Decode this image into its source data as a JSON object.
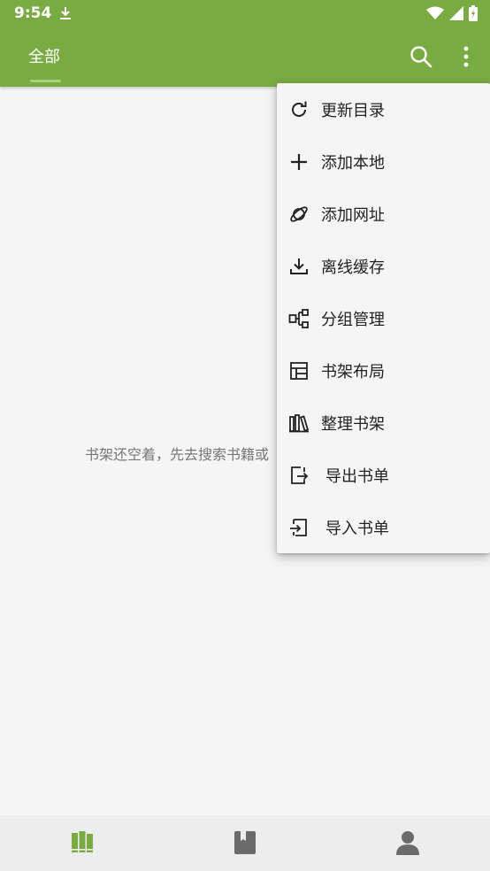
{
  "status": {
    "time": "9:54"
  },
  "appbar": {
    "tab_all": "全部",
    "search_icon": "search-icon",
    "more_icon": "more-vert-icon"
  },
  "empty_state": {
    "message": "书架还空着，先去搜索书籍或"
  },
  "menu": {
    "items": [
      {
        "label": "更新目录",
        "icon": "refresh-icon"
      },
      {
        "label": "添加本地",
        "icon": "plus-icon"
      },
      {
        "label": "添加网址",
        "icon": "planet-icon"
      },
      {
        "label": "离线缓存",
        "icon": "download-icon"
      },
      {
        "label": "分组管理",
        "icon": "group-icon"
      },
      {
        "label": "书架布局",
        "icon": "layout-icon"
      },
      {
        "label": "整理书架",
        "icon": "books-icon"
      },
      {
        "label": "导出书单",
        "icon": "export-icon"
      },
      {
        "label": "导入书单",
        "icon": "import-icon"
      }
    ]
  },
  "bottomnav": {
    "items": [
      {
        "icon": "bookshelf-icon",
        "active": true
      },
      {
        "icon": "book-icon",
        "active": false
      },
      {
        "icon": "person-icon",
        "active": false
      }
    ]
  },
  "colors": {
    "primary": "#7aab43",
    "accent_active": "#7aab43",
    "nav_inactive": "#6b6b6b",
    "menu_bg": "#f5f5f5"
  }
}
